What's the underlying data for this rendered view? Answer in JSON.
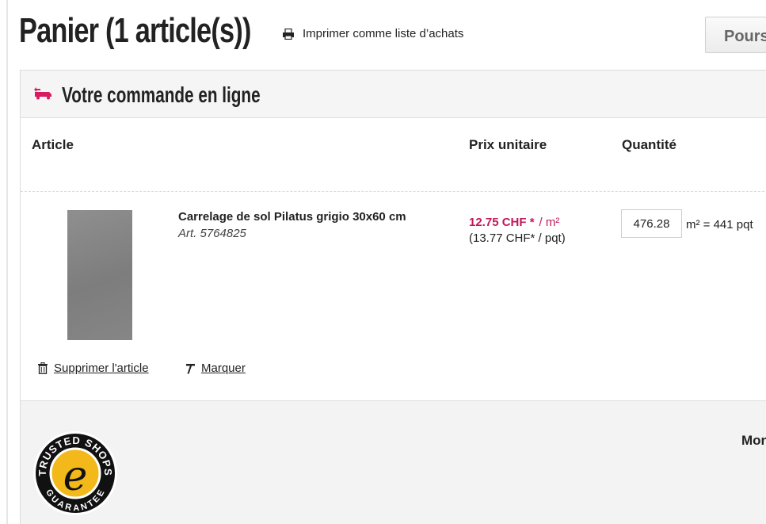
{
  "header": {
    "title": "Panier (1 article(s))",
    "print_label": "Imprimer comme liste d’achats",
    "continue_label": "Poursuivre"
  },
  "order": {
    "title": "Votre commande en ligne",
    "columns": [
      "Article",
      "Prix unitaire",
      "Quantité"
    ]
  },
  "items": [
    {
      "name": "Carrelage de sol Pilatus grigio 30x60 cm",
      "article_no": "Art. 5764825",
      "price": "12.75 CHF *",
      "price_unit": "/ m²",
      "price_alt": "(13.77 CHF*  / pqt)",
      "quantity": "476.28",
      "quantity_conversion": "m² = 441 pqt",
      "delete_label": "Supprimer l'article",
      "mark_label": "Marquer"
    }
  ],
  "summary": {
    "label": "Montant"
  },
  "badge": {
    "text_top": "TRUSTED SHOPS",
    "text_bottom": "GUARANTEE",
    "letter": "e"
  },
  "colors": {
    "accent": "#c2185b",
    "badge_gold": "#f3b91b",
    "panel_bg": "#f5f5f5"
  },
  "icons": [
    "printer-icon",
    "delivery-truck-icon",
    "trash-icon",
    "mark-icon",
    "trusted-shops-badge"
  ]
}
